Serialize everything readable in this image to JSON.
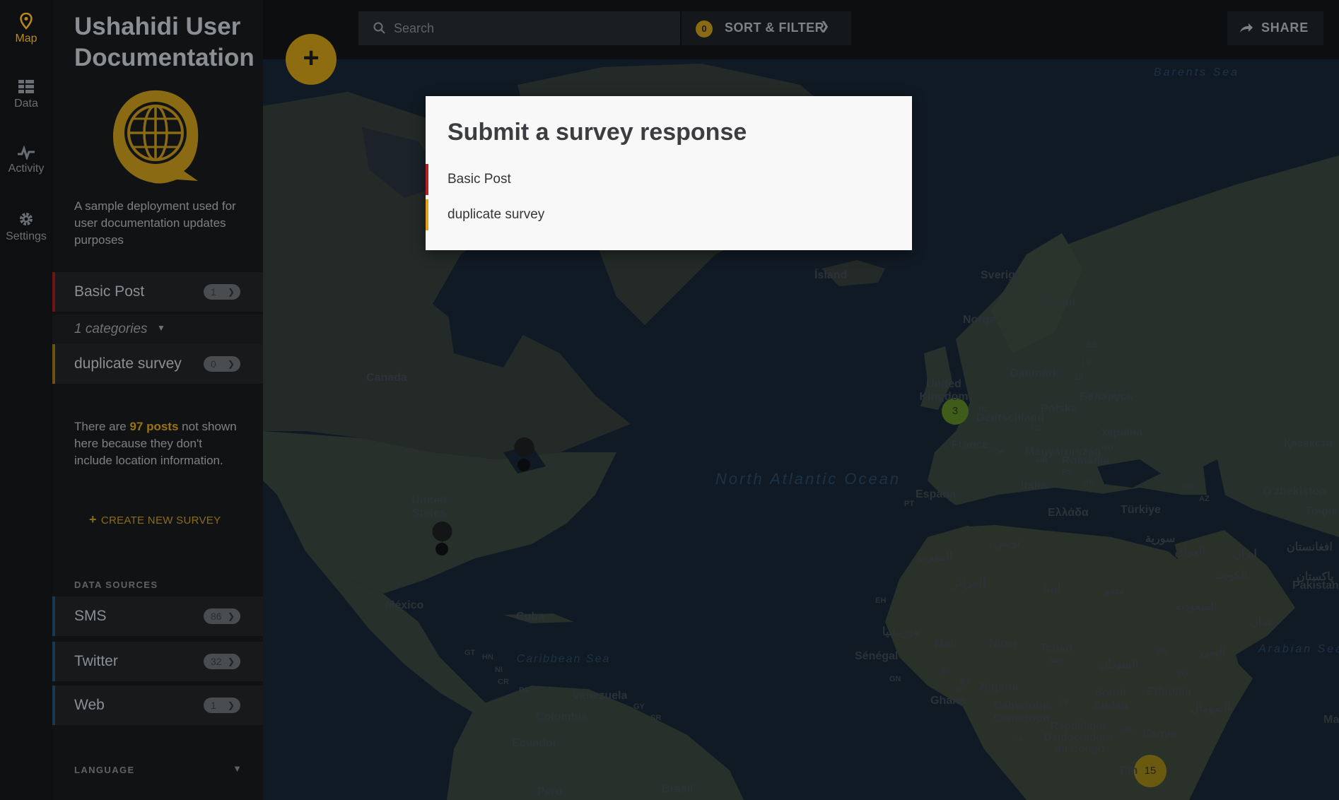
{
  "nav": {
    "items": [
      {
        "label": "Map",
        "icon": "map-pin-icon"
      },
      {
        "label": "Data",
        "icon": "data-grid-icon"
      },
      {
        "label": "Activity",
        "icon": "activity-pulse-icon"
      },
      {
        "label": "Settings",
        "icon": "gear-icon"
      }
    ]
  },
  "sidebar": {
    "deployment_title": "Ushahidi User Documentation",
    "logo_icon": "globe-logo-icon",
    "description": "A sample deployment used for user documentation updates purposes",
    "surveys": [
      {
        "label": "Basic Post",
        "count": "1",
        "color": "#8a1a1a"
      },
      {
        "label": "duplicate survey",
        "count": "0",
        "color": "#8a6a12"
      }
    ],
    "categories_label": "1 categories",
    "note_prefix": "There are",
    "note_highlight": "97 posts",
    "note_suffix": "not shown here because they don't include location information.",
    "create_survey_label": "CREATE NEW SURVEY",
    "data_sources_heading": "DATA SOURCES",
    "data_sources": [
      {
        "label": "SMS",
        "count": "86"
      },
      {
        "label": "Twitter",
        "count": "32"
      },
      {
        "label": "Web",
        "count": "1"
      }
    ],
    "language_heading": "LANGUAGE"
  },
  "topbar": {
    "search_placeholder": "Search",
    "filter_count": "0",
    "sort_filter_label": "SORT & FILTER",
    "share_label": "SHARE"
  },
  "fab_label": "+",
  "modal": {
    "title": "Submit a survey response",
    "items": [
      {
        "label": "Basic Post",
        "color": "#b22222"
      },
      {
        "label": "duplicate survey",
        "color": "#e0a21b"
      }
    ]
  },
  "map": {
    "labels": {
      "barents": "Barents Sea",
      "island": "Ísland",
      "sverige": "Sverige",
      "suomi": "Suomi",
      "norge": "Norge",
      "ee": "EE",
      "lv": "LV",
      "lt": "LT",
      "danmark": "Danmark",
      "belarus": "Беларусь",
      "uk": "United Kingdom",
      "nl": "NL",
      "deutschland": "Deutschland",
      "polska": "Polska",
      "ukraina": "Україна",
      "cz": "CZ",
      "france": "France",
      "ch": "CH",
      "magyar": "Magyarország",
      "md": "MD",
      "hr": "HR",
      "romania": "România",
      "rs": "RS",
      "kazakh": "Қазақста",
      "bg": "BG",
      "espana": "España",
      "italia": "Italia",
      "ge": "GE",
      "az": "AZ",
      "uzbek": "O'zbekiston",
      "pt": "PT",
      "ellada": "Ελλάδα",
      "turkiye": "Türkiye",
      "tojik": "Тоҷик",
      "canada": "Canada",
      "usa": "United States",
      "mexico": "México",
      "cuba": "Cuba",
      "gt": "GT",
      "hn": "HN",
      "ni": "NI",
      "cr": "CR",
      "pa": "PA",
      "venezuela": "Venezuela",
      "gy": "GY",
      "sr": "SR",
      "colombia": "Colombia",
      "ecuador": "Ecuador",
      "peru": "Perú",
      "brasil": "Brasil",
      "caribbean": "Caribbean Sea",
      "north_atlantic": "North Atlantic Ocean",
      "eh": "EH",
      "senegal": "Sénégal",
      "gn": "GN",
      "mali": "Mali",
      "niger": "Niger",
      "tchad": "Tchad",
      "bf": "BF",
      "bj": "BJ",
      "tg": "TG",
      "nigeria": "Nigeria",
      "ghana": "Ghana",
      "cameroun": "Cameroun Cameroon",
      "cf": "CF",
      "south_sudan": "South Sudan",
      "ethiopia": "Ethiopia",
      "er": "ER",
      "dj": "DJ",
      "rdc": "République Démocratique du Congo",
      "ug": "UG",
      "kenya": "Kenya",
      "ga": "GA",
      "tanzania": "Tan",
      "arabian": "Arabian Sea",
      "pakistan": "Pakistan",
      "ma": "Ma",
      "algeria_ar": "الجزائر",
      "libya_ar": "ليبيا",
      "egypt_ar": "مصر",
      "morocco_ar": "المغرب",
      "mauritania_ar": "موريتانيا",
      "sudan_ar": "السودان",
      "saudi_ar": "السعودية",
      "iraq_ar": "العراق",
      "syria_ar": "سورية",
      "iran_ar": "ایران",
      "afghan_ar": "افغانستان",
      "kuwait_ar": "الكويت",
      "oman_ar": "عمان",
      "yemen_ar": "اليمن",
      "somalia_ar": "الصومال",
      "tunisia_ar": "تونس",
      "pakistan_ur": "پاکستان",
      "chad_ar": "تشاد"
    },
    "clusters": [
      {
        "count": "3",
        "color": "#3f5c1a"
      },
      {
        "count": "15",
        "color": "#6a5a10"
      }
    ]
  }
}
